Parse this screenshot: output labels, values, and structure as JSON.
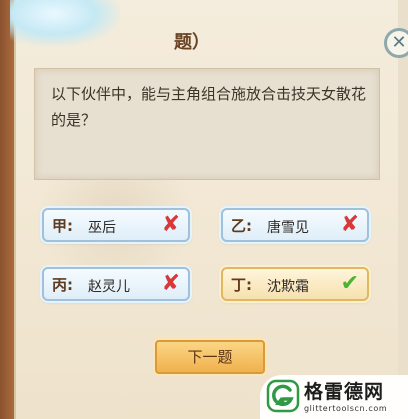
{
  "header": {
    "title_fragment": "题）",
    "close_icon": "close-icon"
  },
  "question": {
    "text": "以下伙伴中，能与主角组合施放合击技天女散花的是？"
  },
  "options": [
    {
      "letter": "甲:",
      "name": "巫后",
      "state": "wrong",
      "mark": "✘"
    },
    {
      "letter": "乙:",
      "name": "唐雪见",
      "state": "wrong",
      "mark": "✘"
    },
    {
      "letter": "丙:",
      "name": "赵灵儿",
      "state": "wrong",
      "mark": "✘"
    },
    {
      "letter": "丁:",
      "name": "沈欺霜",
      "state": "correct",
      "mark": "✔"
    }
  ],
  "next_button": {
    "label": "下一题"
  },
  "watermark": {
    "title": "格雷德网",
    "url": "glittertoolscn.com"
  },
  "colors": {
    "wrong": "#d8383a",
    "correct": "#49b333",
    "option_blue": "#dfeef8",
    "option_gold": "#f6e1ae"
  }
}
